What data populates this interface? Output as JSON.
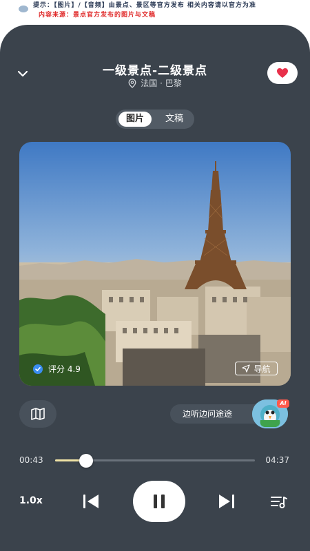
{
  "banner": {
    "line1": "提示：【图片】/【音频】由景点、景区等官方发布  相关内容请以官方为准",
    "line2": "内容来源：景点官方发布的图片与文稿"
  },
  "header": {
    "title": "一级景点-二级景点",
    "location": "法国 · 巴黎"
  },
  "toggle": {
    "options": [
      "图片",
      "文稿"
    ],
    "selected": "图片"
  },
  "photo": {
    "rating_label": "评分 4.9",
    "nav_label": "导航"
  },
  "assistant": {
    "prompt": "边听边问途途",
    "badge": "AI"
  },
  "player": {
    "current_time": "00:43",
    "total_time": "04:37",
    "progress_fraction": 0.155,
    "speed": "1.0x"
  },
  "colors": {
    "panel_bg": "#3b434c",
    "accent_progress": "#f0e3a6",
    "favorite": "#e8304a",
    "verify": "#3a8df0"
  },
  "icons": {
    "collapse": "chevron-down-icon",
    "location": "location-pin-icon",
    "favorite": "heart-icon",
    "map": "map-icon",
    "navigate": "navigation-arrow-icon",
    "prev": "skip-previous-icon",
    "pause": "pause-icon",
    "next": "skip-next-icon",
    "playlist": "playlist-icon"
  }
}
